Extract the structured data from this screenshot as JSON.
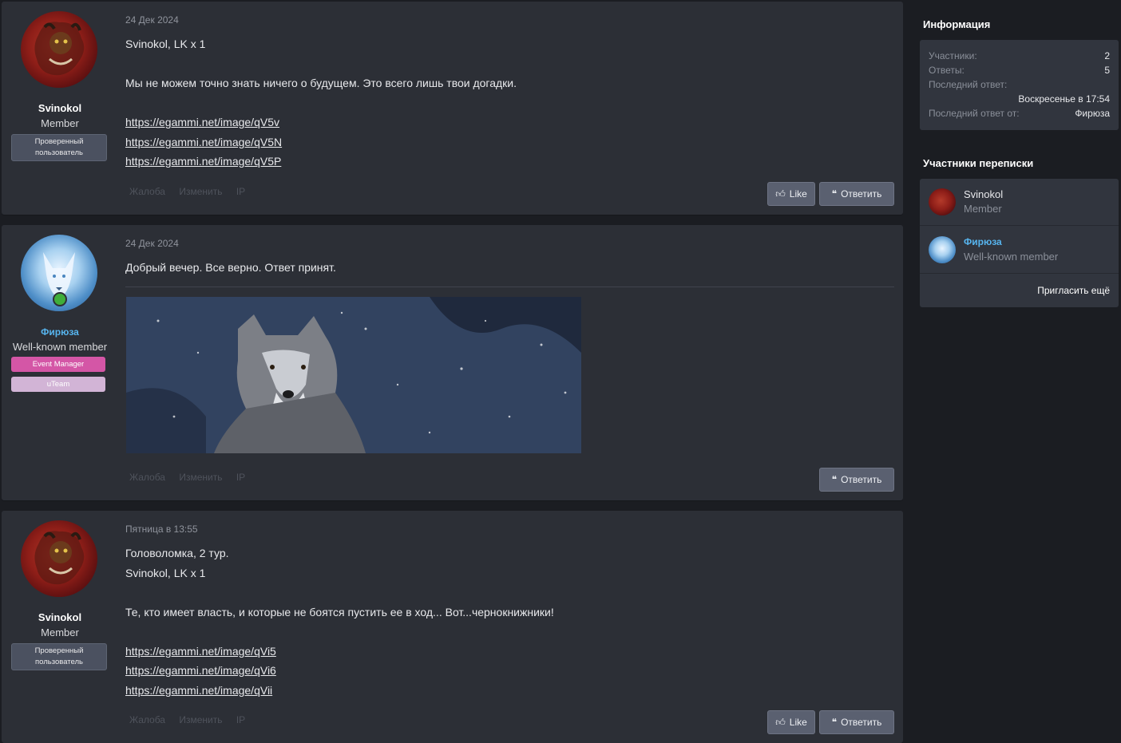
{
  "posts": [
    {
      "user": {
        "name": "Svinokol",
        "title": "Member",
        "badges": [
          "Проверенный пользователь"
        ]
      },
      "date": "24 Дек 2024",
      "lines": [
        "Svinokol, LK x 1",
        "Мы не можем точно знать ничего о будущем. Это всего лишь твои догадки."
      ],
      "links": [
        "https://egammi.net/image/qV5v",
        "https://egammi.net/image/qV5N",
        "https://egammi.net/image/qV5P"
      ],
      "actions": [
        "Жалоба",
        "Изменить",
        "IP"
      ],
      "like_label": "Like",
      "reply_label": "Ответить"
    },
    {
      "user": {
        "name": "Фирюза",
        "title": "Well-known member",
        "badges": [
          "Event Manager",
          "uTeam"
        ]
      },
      "date": "24 Дек 2024",
      "lines": [
        "Добрый вечер. Все верно. Ответ принят."
      ],
      "image": "wolf-in-snow",
      "actions": [
        "Жалоба",
        "Изменить",
        "IP"
      ],
      "reply_label": "Ответить"
    },
    {
      "user": {
        "name": "Svinokol",
        "title": "Member",
        "badges": [
          "Проверенный пользователь"
        ]
      },
      "date": "Пятница в 13:55",
      "lines": [
        "Головоломка, 2 тур.",
        "Svinokol, LK x 1",
        "Те, кто имеет власть, и которые не боятся пустить ее в ход... Вот...чернокнижники!"
      ],
      "links": [
        "https://egammi.net/image/qVi5",
        "https://egammi.net/image/qVi6",
        "https://egammi.net/image/qVii"
      ],
      "actions": [
        "Жалоба",
        "Изменить",
        "IP"
      ],
      "like_label": "Like",
      "reply_label": "Ответить"
    }
  ],
  "sidebar": {
    "info_title": "Информация",
    "info": {
      "participants_label": "Участники:",
      "participants_value": "2",
      "replies_label": "Ответы:",
      "replies_value": "5",
      "last_reply_label": "Последний ответ:",
      "last_reply_value": "Воскресенье в 17:54",
      "last_reply_by_label": "Последний ответ от:",
      "last_reply_by_value": "Фирюза"
    },
    "members_title": "Участники переписки",
    "members": [
      {
        "name": "Svinokol",
        "title": "Member"
      },
      {
        "name": "Фирюза",
        "title": "Well-known member"
      }
    ],
    "invite_label": "Пригласить ещё"
  },
  "colors": {
    "accent_blue": "#57b5ef",
    "event_manager": "#d456a6",
    "uteam": "#d2b4d6",
    "online": "#3fae3a"
  }
}
